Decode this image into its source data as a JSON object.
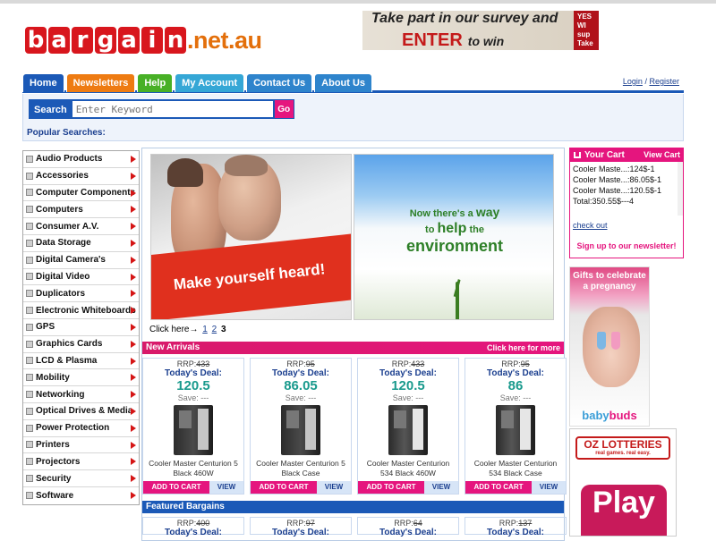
{
  "header": {
    "logo_letters": [
      "b",
      "a",
      "r",
      "g",
      "a",
      "i",
      "n"
    ],
    "logo_suffix": ".net.au",
    "ad": {
      "line1": "Take part in our survey and",
      "line2": "ENTER",
      "line2_suffix": "to win",
      "side_text": "YES WI sup Take m"
    }
  },
  "nav": {
    "tabs": [
      {
        "label": "Home",
        "color": "#1b59b7"
      },
      {
        "label": "Newsletters",
        "color": "#ee7b12"
      },
      {
        "label": "Help",
        "color": "#48b026"
      },
      {
        "label": "My Account",
        "color": "#35a7d6"
      },
      {
        "label": "Contact Us",
        "color": "#2e84cc"
      },
      {
        "label": "About Us",
        "color": "#2e84cc"
      }
    ],
    "login_label": "Login",
    "separator": "/",
    "register_label": "Register"
  },
  "search": {
    "label": "Search",
    "placeholder": "Enter Keyword",
    "go_label": "Go",
    "popular_label": "Popular Searches:"
  },
  "categories": [
    "Audio Products",
    "Accessories",
    "Computer Components",
    "Computers",
    "Consumer A.V.",
    "Data Storage",
    "Digital Camera's",
    "Digital Video",
    "Duplicators",
    "Electronic Whiteboards",
    "GPS",
    "Graphics Cards",
    "LCD & Plasma",
    "Mobility",
    "Networking",
    "Optical Drives & Media",
    "Power Protection",
    "Printers",
    "Projectors",
    "Security",
    "Software"
  ],
  "slider": {
    "left_text": "Make yourself heard!",
    "right_line1_pre": "Now there's a",
    "right_line1_em": "way",
    "right_line2_pre": "to",
    "right_line2_em": "help",
    "right_line2_post": "the",
    "right_line3": "environment",
    "nav_label": "Click here→",
    "pages": [
      "1",
      "2"
    ],
    "current_page": "3"
  },
  "new_arrivals": {
    "title": "New Arrivals",
    "more_label": "Click here for more",
    "products": [
      {
        "rrp_label": "RRP:",
        "rrp": "433",
        "deal_label": "Today's Deal:",
        "price": "120.5",
        "save": "Save: ---",
        "name": "Cooler Master Centurion 5 Black 460W",
        "case": "black"
      },
      {
        "rrp_label": "RRP:",
        "rrp": "95",
        "deal_label": "Today's Deal:",
        "price": "86.05",
        "save": "Save: ---",
        "name": "Cooler Master Centurion 5 Black Case",
        "case": "black"
      },
      {
        "rrp_label": "RRP:",
        "rrp": "433",
        "deal_label": "Today's Deal:",
        "price": "120.5",
        "save": "Save: ---",
        "name": "Cooler Master Centurion 534 Black 460W",
        "case": "silver"
      },
      {
        "rrp_label": "RRP:",
        "rrp": "95",
        "deal_label": "Today's Deal:",
        "price": "86",
        "save": "Save: ---",
        "name": "Cooler Master Centurion 534 Black Case",
        "case": "silver"
      }
    ],
    "add_to_cart_label": "ADD TO CART",
    "view_label": "VIEW"
  },
  "featured": {
    "title": "Featured Bargains",
    "products": [
      {
        "rrp_label": "RRP:",
        "rrp": "400",
        "deal_label": "Today's Deal:"
      },
      {
        "rrp_label": "RRP:",
        "rrp": "97",
        "deal_label": "Today's Deal:"
      },
      {
        "rrp_label": "RRP:",
        "rrp": "64",
        "deal_label": "Today's Deal:"
      },
      {
        "rrp_label": "RRP:",
        "rrp": "137",
        "deal_label": "Today's Deal:"
      }
    ]
  },
  "cart": {
    "title": "Your Cart",
    "view_label": "View Cart",
    "items": [
      "Cooler Maste...:124$-1",
      "Cooler Maste...:86.05$-1",
      "Cooler Maste...:120.5$-1",
      "Total:350.55$---4"
    ],
    "checkout_label": "check out",
    "signup_label": "Sign up to our newsletter!"
  },
  "ads": {
    "babybuds_title": "Gifts to celebrate a pregnancy",
    "babybuds_logo_a": "baby",
    "babybuds_logo_b": "buds",
    "oz_logo": "OZ LOTTERIES",
    "oz_tagline": "real games. real easy.",
    "oz_play": "Play"
  }
}
